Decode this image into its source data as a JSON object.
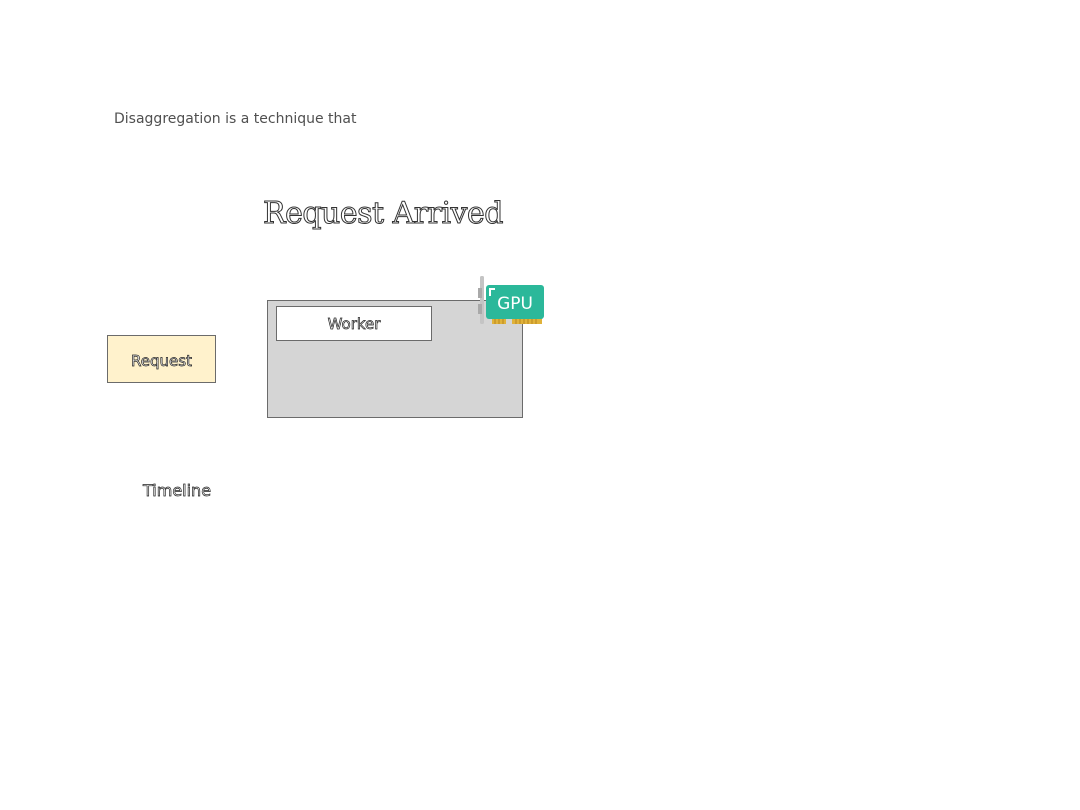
{
  "intro_text": "Disaggregation is a technique that",
  "heading": "Request Arrived",
  "request": {
    "label": "Request",
    "fill": "#fff2cc"
  },
  "machine": {
    "fill": "#d5d5d5"
  },
  "worker": {
    "label": "Worker"
  },
  "gpu": {
    "label": "GPU",
    "icon": "gpu-card-icon",
    "color": "#2bb89a"
  },
  "timeline": {
    "label": "Timeline"
  }
}
